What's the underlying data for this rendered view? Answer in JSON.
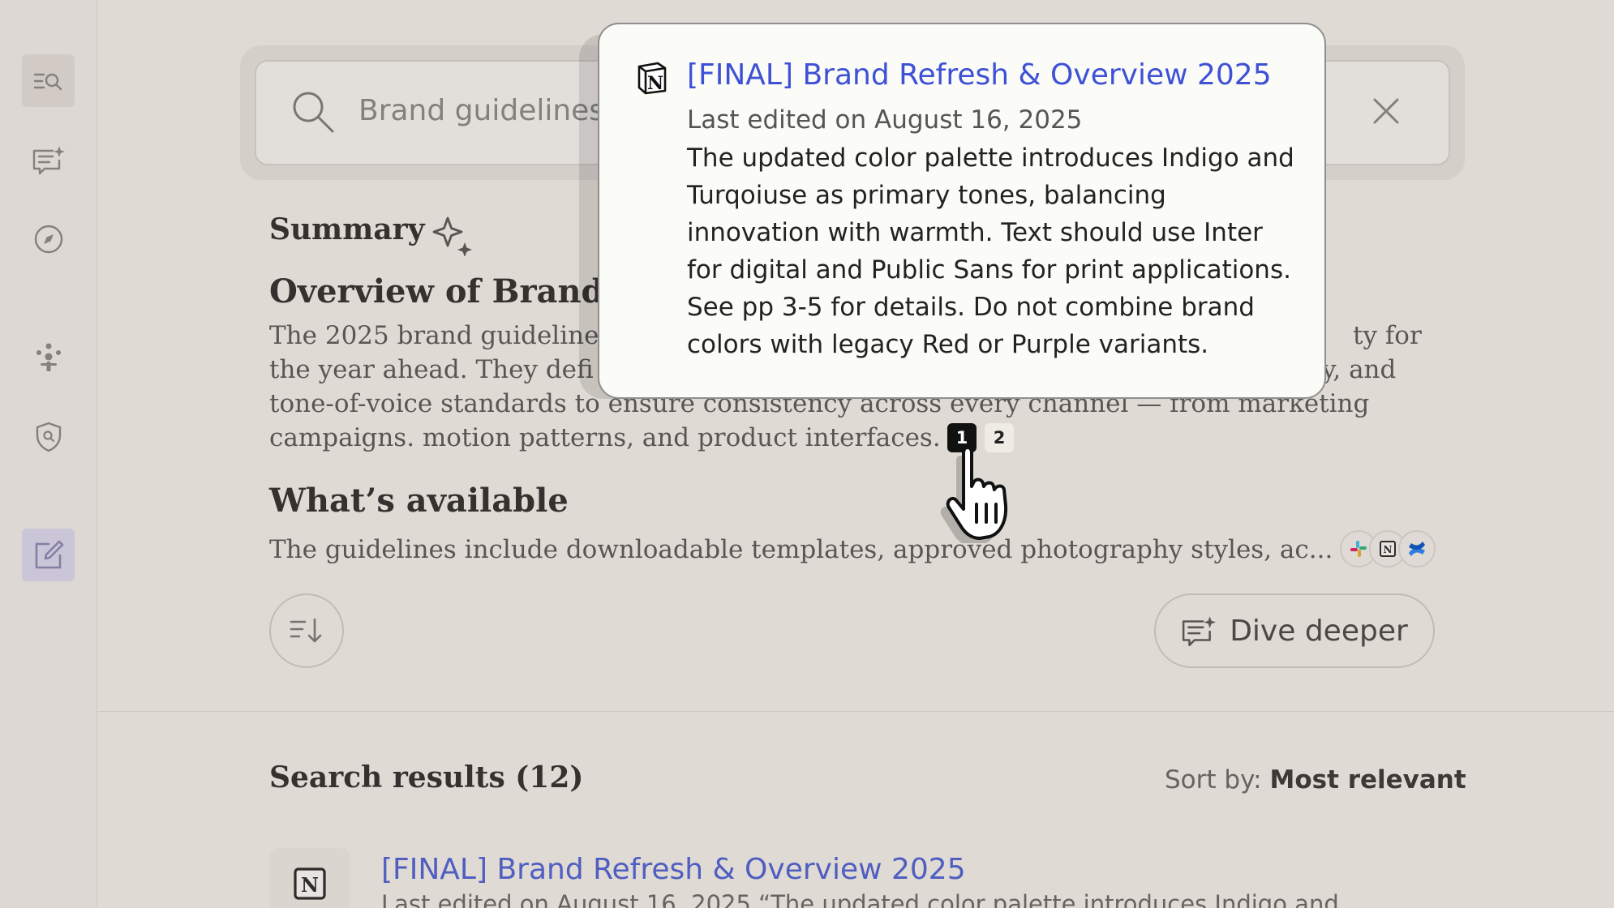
{
  "search": {
    "query": "Brand guidelines 2"
  },
  "summary": {
    "title": "Summary",
    "overview_heading": "Overview of Brand",
    "overview_lines": [
      "The 2025 brand guideline",
      "the year ahead. They defi",
      "tone-of-voice standards to ensure consistency across every channel — from marketing",
      "campaigns. motion patterns, and product interfaces."
    ],
    "overview_right_fragments": [
      "ty for",
      "hy, and"
    ],
    "available_heading": "What’s available",
    "available_text": "The guidelines include downloadable templates, approved photography styles, ac...",
    "source_icons": [
      "slack-icon",
      "notion-icon",
      "confluence-icon"
    ],
    "citation_chips": [
      "1",
      "2"
    ],
    "active_citation": "1",
    "dive_deeper_label": "Dive deeper"
  },
  "popover": {
    "title": "[FINAL] Brand Refresh & Overview 2025",
    "date": "Last edited on August 16, 2025",
    "body": "The updated color palette introduces Indigo and Turqoiuse as primary tones, balancing innovation with warmth. Text should use Inter for digital and Public Sans for print applications. See pp 3-5 for details. Do not combine brand colors with legacy Red or Purple variants."
  },
  "results": {
    "title": "Search results (12)",
    "sort_label": "Sort by:",
    "sort_value": "Most relevant",
    "items": [
      {
        "title": "[FINAL] Brand Refresh & Overview 2025",
        "snippet": "Last edited on August 16, 2025 “The updated color palette introduces Indigo and"
      }
    ]
  },
  "colors": {
    "link": "#3e51d6",
    "active_nav": "#dedbf3",
    "chip_active": "#111111"
  }
}
